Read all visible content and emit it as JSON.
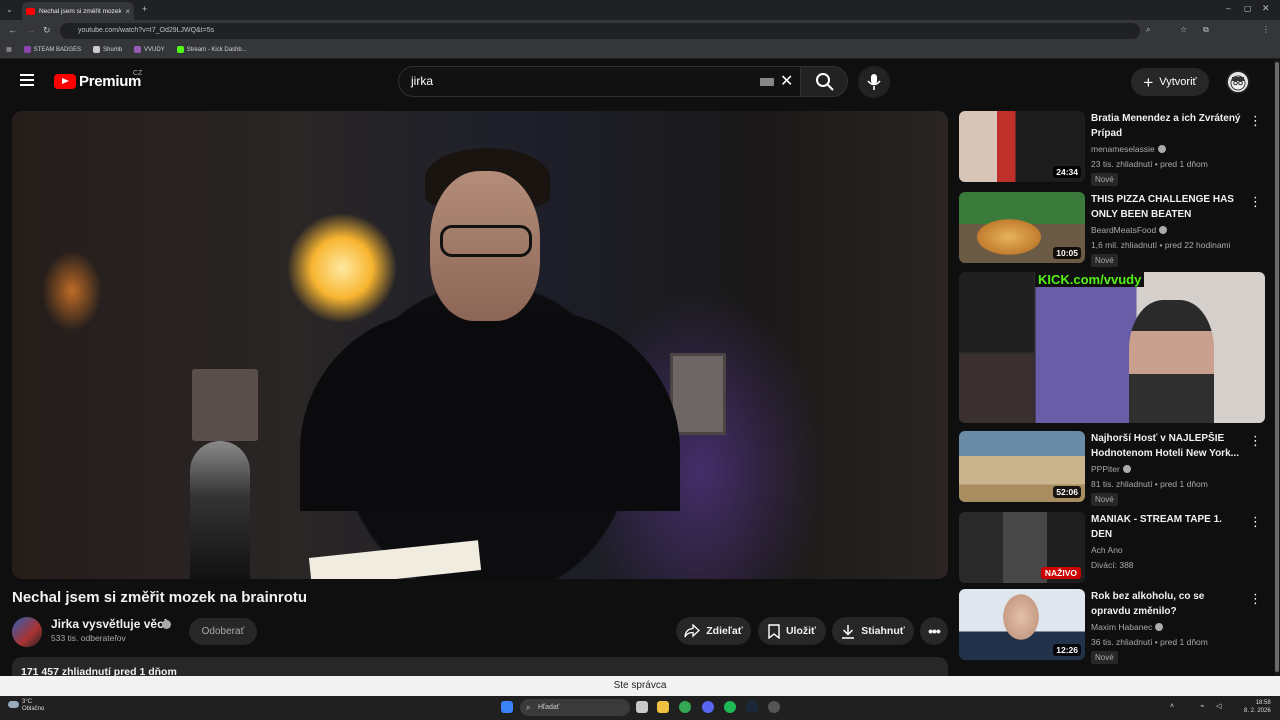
{
  "browser": {
    "tab_title": "Nechal jsem si změřit mozek na",
    "url": "youtube.com/watch?v=I7_Od29LJWQ&t=5s",
    "bookmarks": [
      {
        "label": "STEAM BADGES",
        "color": "#8e44ad"
      },
      {
        "label": "Shumb",
        "color": "#cccccc"
      },
      {
        "label": "VVUDY",
        "color": "#9b59b6"
      },
      {
        "label": "Stream - Kick Dashb...",
        "color": "#53fc18"
      }
    ]
  },
  "header": {
    "logo_text": "Premium",
    "region": "CZ",
    "search_value": "jirka",
    "create_label": "Vytvoriť"
  },
  "video": {
    "title": "Nechal jsem si změřit mozek na brainrotu",
    "channel_name": "Jirka vysvětluje věci",
    "subscribers": "533 tis. odberateľov",
    "unsubscribe_label": "Odoberať",
    "share_label": "Zdieľať",
    "save_label": "Uložiť",
    "download_label": "Stiahnuť",
    "meta": "171 457 zhliadnutí  pred 1 dňom"
  },
  "recommendations": [
    {
      "title": "Bratia Menendez a ich Zvrátený Prípad",
      "channel": "menameselassie",
      "verified": true,
      "stats": "23 tis. zhliadnutí • pred 1 dňom",
      "badge": "Nové",
      "duration": "24:34"
    },
    {
      "title": "THIS PIZZA CHALLENGE HAS ONLY BEEN BEATEN ONCE...B...",
      "channel": "BeardMeatsFood",
      "verified": true,
      "stats": "1,6 mil. zhliadnutí • pred 22 hodinami",
      "badge": "Nové",
      "duration": "10:05"
    },
    {
      "title": "Najhorší Hosť v NAJLEPŠIE Hodnotenom Hoteli New York...",
      "channel": "PPPiter",
      "verified": true,
      "stats": "81 tis. zhliadnutí • pred 1 dňom",
      "badge": "Nové",
      "duration": "52:06"
    },
    {
      "title": "MANIAK - STREAM TAPE 1. DEN",
      "channel": "Ach Ano",
      "verified": false,
      "stats": "Divácí: 388",
      "badge": "",
      "live": "NAŽIVO"
    },
    {
      "title": "Rok bez alkoholu, co se opravdu změnilo?",
      "channel": "Maxim Habanec",
      "verified": true,
      "stats": "36 tis. zhliadnutí • pred 1 dňom",
      "badge": "Nové",
      "duration": "12:26"
    }
  ],
  "promo": {
    "kick_text": "KICK.com/vvudy"
  },
  "status_bar": {
    "text": "Ste správca"
  },
  "taskbar": {
    "weather_temp": "3°C",
    "weather_desc": "Oblačno",
    "search_placeholder": "Hľadať",
    "time": "18:58",
    "date": "8. 2. 2026"
  },
  "thumb_colors": [
    "#c9302c",
    "#3a6b2f",
    "#6c5ba8",
    "#b89a5e",
    "#2a2a2a",
    "#5b7fa6"
  ]
}
